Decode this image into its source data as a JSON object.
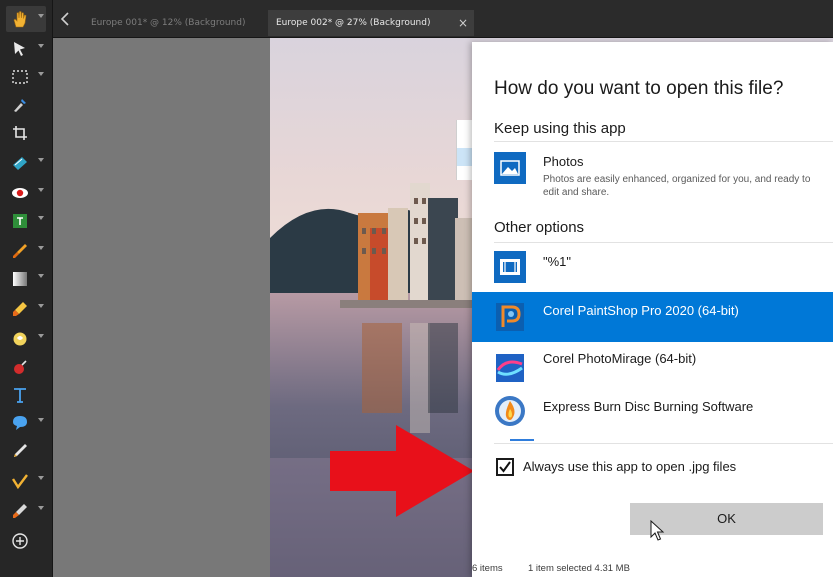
{
  "toolbar": {
    "tools": [
      {
        "icon": "pan-hand-icon",
        "has_menu": true,
        "active": true
      },
      {
        "icon": "pick-arrow-icon",
        "has_menu": true
      },
      {
        "icon": "selection-marquee-icon",
        "has_menu": true
      },
      {
        "icon": "dropper-icon",
        "has_menu": false
      },
      {
        "icon": "crop-icon",
        "has_menu": false
      },
      {
        "icon": "straighten-icon",
        "has_menu": true
      },
      {
        "icon": "red-eye-icon",
        "has_menu": true
      },
      {
        "icon": "text-box-icon",
        "has_menu": true
      },
      {
        "icon": "paint-brush-icon",
        "has_menu": true
      },
      {
        "icon": "fill-gradient-icon",
        "has_menu": true
      },
      {
        "icon": "eraser-icon",
        "has_menu": true
      },
      {
        "icon": "smudge-icon",
        "has_menu": true
      },
      {
        "icon": "pin-icon",
        "has_menu": false
      },
      {
        "icon": "text-tool-icon",
        "has_menu": false
      },
      {
        "icon": "shape-icon",
        "has_menu": true
      },
      {
        "icon": "pen-icon",
        "has_menu": false
      },
      {
        "icon": "retouch-icon",
        "has_menu": true
      },
      {
        "icon": "clone-brush-icon",
        "has_menu": true
      },
      {
        "icon": "add-circle-icon",
        "has_menu": false
      }
    ]
  },
  "tabs": {
    "items": [
      {
        "label": "Europe 001* @  12% (Background)",
        "active": false
      },
      {
        "label": "Europe 002* @  27% (Background)",
        "active": true
      }
    ],
    "close_glyph": "×"
  },
  "dialog": {
    "title": "How do you want to open this file?",
    "keep_heading": "Keep using this app",
    "other_heading": "Other options",
    "apps": {
      "photos": {
        "name": "Photos",
        "description": "Photos are easily enhanced, organized for you, and ready to edit and share."
      },
      "pct": {
        "name": "\"%1\""
      },
      "paintshop": {
        "name": "Corel PaintShop Pro 2020 (64-bit)",
        "selected": true
      },
      "photomirage": {
        "name": "Corel PhotoMirage (64-bit)"
      },
      "expressburn": {
        "name": "Express Burn Disc Burning Software"
      }
    },
    "always_use": {
      "label": "Always use this app to open .jpg files",
      "checked": true
    },
    "ok_label": "OK"
  },
  "statusbar": {
    "items": "6 items",
    "selected": "1 item selected  4.31 MB"
  },
  "colors": {
    "selection_blue": "#0078d7",
    "arrow_red": "#e8101a",
    "toolbar_bg": "#262626"
  }
}
